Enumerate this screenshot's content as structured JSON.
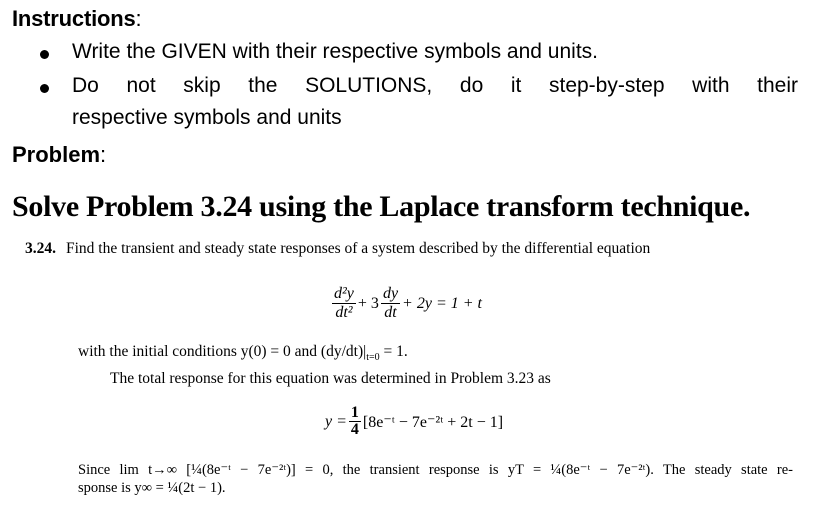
{
  "instructions": {
    "heading": "Instructions",
    "heading_colon": ":",
    "bullets": [
      "Write the GIVEN with their respective symbols and units.",
      "Do not skip the SOLUTIONS, do it step-by-step with their",
      "respective symbols and units"
    ]
  },
  "problem": {
    "heading": "Problem",
    "heading_colon": ":",
    "title": "Solve Problem 3.24 using the Laplace transform technique.",
    "number": "3.24.",
    "statement": "Find the transient and steady state responses of a system described by the differential equation",
    "equation": {
      "term1_num": "d²y",
      "term1_den": "dt²",
      "plus3": "+ 3",
      "term2_num": "dy",
      "term2_den": "dt",
      "rest": "+ 2y = 1 + t"
    },
    "initial_conditions": "with the initial conditions y(0) = 0 and (dy/dt)|",
    "ic_sub": "t=0",
    "ic_end": " = 1.",
    "total_response_intro": "The total response for this equation was determined in Problem 3.23 as",
    "total_response": {
      "lhs": "y =",
      "frac_num": "1",
      "frac_den": "4",
      "body": "[8e⁻ᵗ − 7e⁻²ᵗ + 2t − 1]"
    },
    "conclusion_line1": "Since lim t→∞ [¼(8e⁻ᵗ − 7e⁻²ᵗ)] = 0, the transient response is yT = ¼(8e⁻ᵗ − 7e⁻²ᵗ). The steady state re-",
    "conclusion_line2": "sponse is y∞ = ¼(2t − 1)."
  }
}
